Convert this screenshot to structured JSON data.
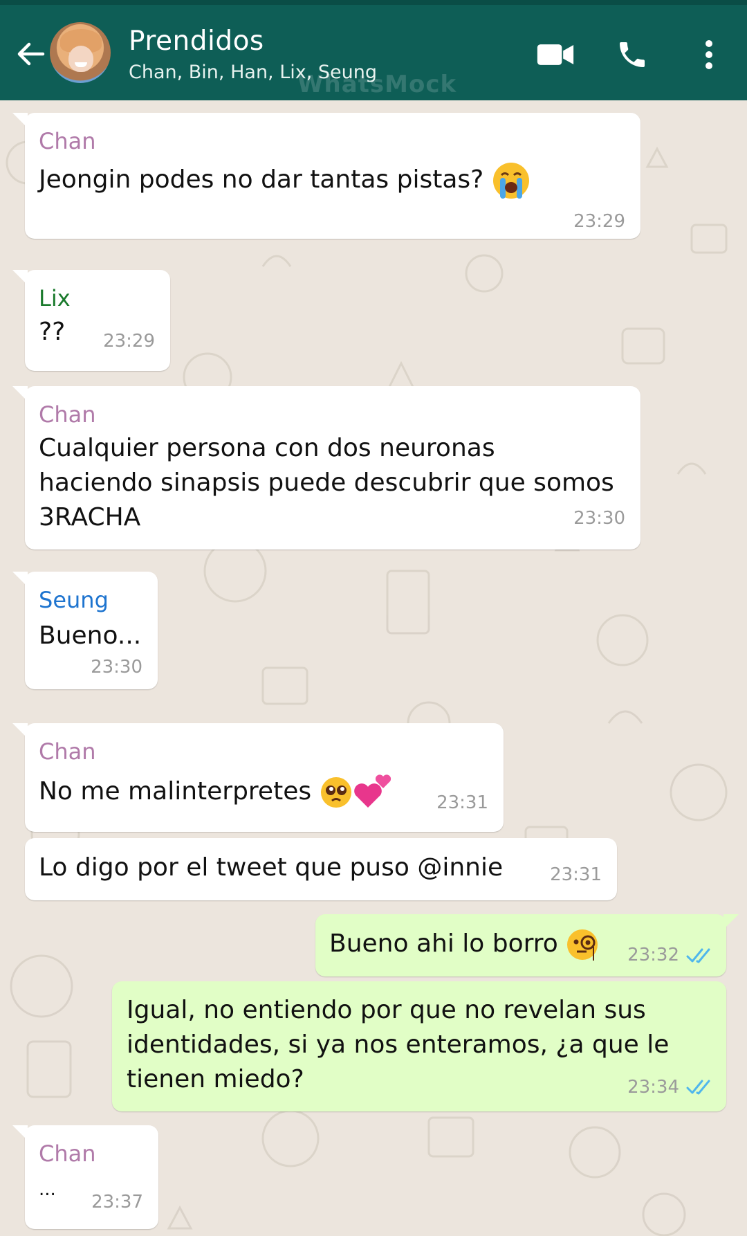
{
  "header": {
    "title": "Prendidos",
    "members": "Chan, Bin, Han, Lix, Seung",
    "watermark": "WhatsMock"
  },
  "colors": {
    "header_bg": "#0e5e56",
    "chat_bg": "#ece5dd",
    "incoming_bubble": "#ffffff",
    "outgoing_bubble": "#e1fec6",
    "read_ticks": "#4fb6ec",
    "sender_chan": "#b07aa9",
    "sender_lix": "#1a7a2c",
    "sender_seung": "#1e74cf"
  },
  "icons": {
    "back": "arrow-left-icon",
    "video": "video-camera-icon",
    "call": "phone-icon",
    "menu": "more-vertical-icon"
  },
  "messages": [
    {
      "sender": "Chan",
      "text": "Jeongin podes no dar tantas pistas?",
      "emoji": "loudly-crying-face",
      "time": "23:29"
    },
    {
      "sender": "Lix",
      "text": "??",
      "time": "23:29"
    },
    {
      "sender": "Chan",
      "text": "Cualquier persona con dos neuronas\nhaciendo sinapsis puede descubrir que somos\n3RACHA",
      "time": "23:30"
    },
    {
      "sender": "Seung",
      "text": "Bueno...",
      "time": "23:30"
    },
    {
      "sender": "Chan",
      "text": "No me malinterpretes",
      "emoji": "pleading-face two-hearts",
      "time": "23:31"
    },
    {
      "text": "Lo digo por el tweet que puso @innie",
      "time": "23:31"
    },
    {
      "outgoing": true,
      "text": "Bueno ahi lo borro",
      "emoji": "face-with-monocle",
      "time": "23:32",
      "status": "read"
    },
    {
      "outgoing": true,
      "text": "Igual, no entiendo por que no revelan sus\nidentidades, si ya nos enteramos, ¿a que le\ntienen miedo?",
      "time": "23:34",
      "status": "read"
    },
    {
      "sender": "Chan",
      "text": "...",
      "time": "23:37"
    }
  ]
}
